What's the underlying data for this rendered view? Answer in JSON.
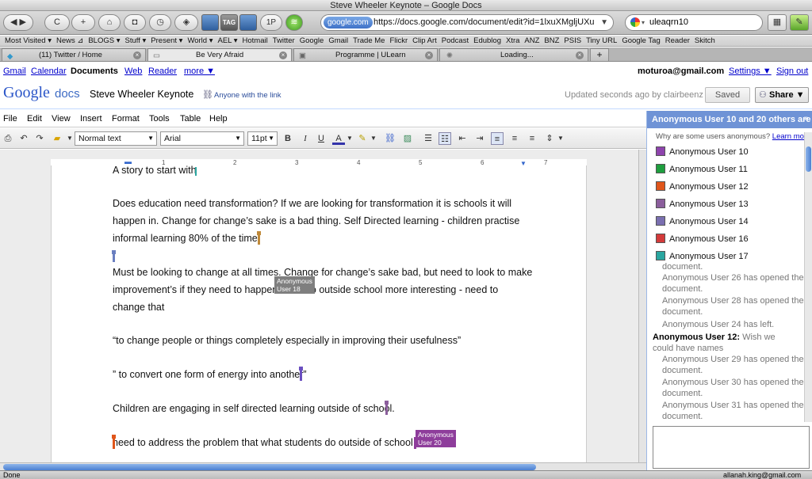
{
  "window": {
    "title": "Steve Wheeler Keynote – Google Docs"
  },
  "browser": {
    "nav_buttons": [
      {
        "label": "◀"
      },
      {
        "label": "▶"
      },
      {
        "label": "C"
      },
      {
        "label": "+"
      },
      {
        "label": "⌂"
      },
      {
        "label": "◘"
      },
      {
        "label": "◷"
      },
      {
        "label": "◈"
      }
    ],
    "ext_buttons": [
      {
        "label": "TAG"
      },
      {
        "label": "1P"
      }
    ],
    "url_site": "google.com",
    "url": "https://docs.google.com/document/edit?id=1lxuXMgljUXu",
    "search_value": "uleaqrn10"
  },
  "bookmarks": [
    "Most Visited ▾",
    "News ⊿",
    "BLOGS ▾",
    "Stuff ▾",
    "Present ▾",
    "World ▾",
    "AEL ▾",
    "Hotmail",
    "Twitter",
    "Google",
    "Gmail",
    "Trade Me",
    "Flickr",
    "Clip Art",
    "Podcast",
    "Edublog",
    "Xtra",
    "ANZ",
    "BNZ",
    "PSIS",
    "Tiny URL",
    "Google Tag",
    "Reader",
    "Skitch"
  ],
  "tabs": [
    {
      "label": "(11) Twitter / Home"
    },
    {
      "label": "Be Very Afraid"
    },
    {
      "label": "Programme | ULearn"
    },
    {
      "label": "Loading..."
    }
  ],
  "google_bar": {
    "links": [
      "Gmail",
      "Calendar",
      "Documents",
      "Web",
      "Reader",
      "more ▼"
    ],
    "account": "moturoa@gmail.com",
    "settings": "Settings ▼",
    "signout": "Sign out"
  },
  "doc_header": {
    "logo_google": "Google",
    "logo_docs": "docs",
    "title": "Steve Wheeler Keynote",
    "sharing": "Anyone with the link",
    "updated": "Updated seconds ago by clairbeenz",
    "saved": "Saved",
    "share": "Share ▼"
  },
  "menus": [
    "File",
    "Edit",
    "View",
    "Insert",
    "Format",
    "Tools",
    "Table",
    "Help"
  ],
  "toolbar": {
    "style": "Normal text",
    "font": "Arial",
    "size": "11pt",
    "bold": "B",
    "italic": "I",
    "underline": "U",
    "text_color": "A"
  },
  "ruler": {
    "marks": [
      "1",
      "2",
      "3",
      "4",
      "5",
      "6",
      "7"
    ]
  },
  "document": {
    "paragraphs": [
      "A story to start with",
      "Does education need transformation? If we are looking for transformation it is schools it will",
      "happen in. Change for change’s sake is a bad thing. Self Directed learning - children practise",
      "informal learning 80% of the time.",
      "Must be looking to change at all times. Change for change’s sake bad, but need to look to make",
      "improvement’s if they need to happen. Kids do outside school more interesting - need to",
      "change that",
      "“to change people or things completely especially in improving their usefulness”",
      "” to convert one form of energy into another”",
      "Children are engaging in self directed learning outside of school.",
      "need to address the problem that what students do outside of school is"
    ],
    "cursor_labels": [
      {
        "line1": "Anonymous",
        "line2": "User 18"
      },
      {
        "line1": "Anonymous",
        "line2": "User 20"
      }
    ]
  },
  "sidebar": {
    "header": "Anonymous User 10 and 20 others are",
    "why": "Why are some users anonymous?",
    "learn_more": "Learn more",
    "users": [
      {
        "name": "Anonymous User 10",
        "color": "#8e44ad"
      },
      {
        "name": "Anonymous User 11",
        "color": "#1e9e3e"
      },
      {
        "name": "Anonymous User 12",
        "color": "#e0561b"
      },
      {
        "name": "Anonymous User 13",
        "color": "#8b5e9c"
      },
      {
        "name": "Anonymous User 14",
        "color": "#7a6fb0"
      },
      {
        "name": "Anonymous User 16",
        "color": "#d33a3a"
      },
      {
        "name": "Anonymous User 17",
        "color": "#2aa6a0"
      }
    ],
    "log": [
      {
        "text": "document."
      },
      {
        "text": "Anonymous User 26 has opened the document."
      },
      {
        "text": "Anonymous User 28 has opened the document."
      },
      {
        "text": "Anonymous User 24 has left."
      },
      {
        "who": "Anonymous User 12:",
        "text": "Wish we could have names"
      },
      {
        "text": "Anonymous User 29 has opened the document."
      },
      {
        "text": "Anonymous User 30 has opened the document."
      },
      {
        "text": "Anonymous User 31 has opened the document."
      }
    ]
  },
  "status": {
    "left": "Done",
    "right": "allanah.king@gmail.com"
  },
  "colors": {
    "sidebar_header": "#6f93d6",
    "link": "#0000cc",
    "user18": "#7f7f7f",
    "user20": "#8e3d9b"
  }
}
